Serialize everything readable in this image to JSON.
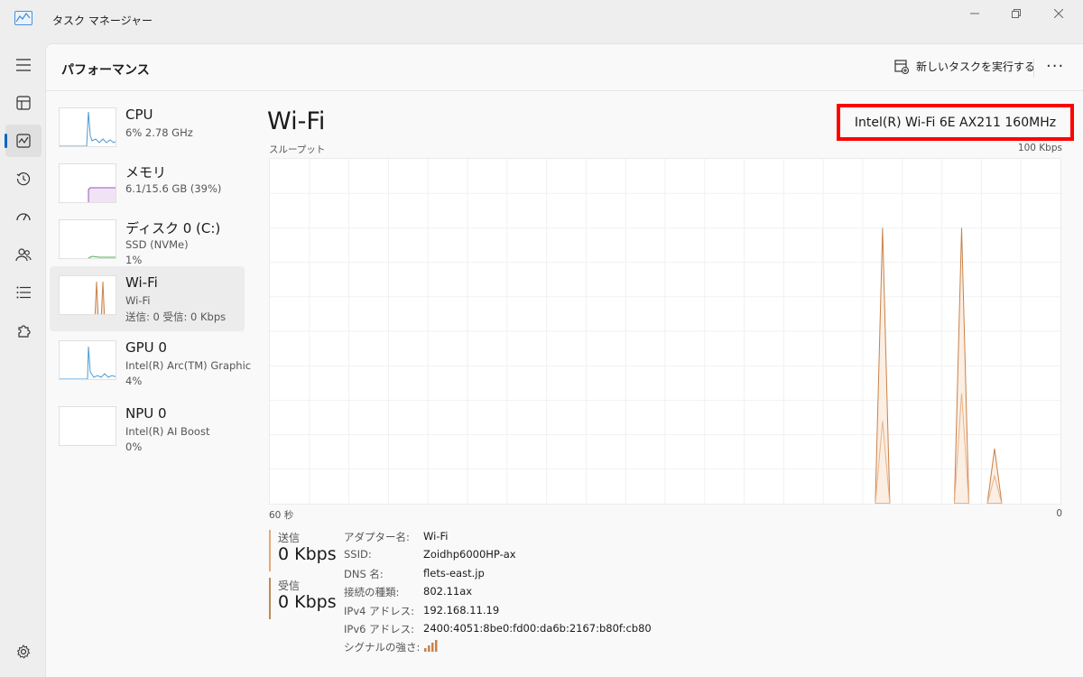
{
  "window": {
    "title": "タスク マネージャー"
  },
  "rail": {
    "items": [
      {
        "name": "menu",
        "icon": "hamburger-menu-icon"
      },
      {
        "name": "processes",
        "icon": "processes-icon"
      },
      {
        "name": "performance",
        "icon": "performance-icon",
        "active": true
      },
      {
        "name": "app-history",
        "icon": "history-icon"
      },
      {
        "name": "startup",
        "icon": "startup-speedometer-icon"
      },
      {
        "name": "users",
        "icon": "users-icon"
      },
      {
        "name": "details",
        "icon": "details-list-icon"
      },
      {
        "name": "services",
        "icon": "services-puzzle-icon"
      }
    ],
    "settings_icon": "settings-gear-icon"
  },
  "header": {
    "title": "パフォーマンス",
    "run_task_label": "新しいタスクを実行する",
    "more_label": "···"
  },
  "devices": [
    {
      "name": "CPU",
      "line1": "6%  2.78 GHz",
      "line2": "",
      "color": "#4a9ad4"
    },
    {
      "name": "メモリ",
      "line1": "6.1/15.6 GB (39%)",
      "line2": "",
      "color": "#9b59b6"
    },
    {
      "name": "ディスク 0 (C:)",
      "line1": "SSD (NVMe)",
      "line2": "1%",
      "color": "#4caf50"
    },
    {
      "name": "Wi-Fi",
      "line1": "Wi-Fi",
      "line2": "送信: 0  受信: 0 Kbps",
      "color": "#c8824a",
      "selected": true
    },
    {
      "name": "GPU 0",
      "line1": "Intel(R) Arc(TM) Graphic",
      "line2": "4%",
      "color": "#4a9ad4"
    },
    {
      "name": "NPU 0",
      "line1": "Intel(R) AI Boost",
      "line2": "0%",
      "color": "#4a9ad4"
    }
  ],
  "detail": {
    "title": "Wi-Fi",
    "adapter": "Intel(R) Wi-Fi 6E AX211 160MHz",
    "graph_label": "スループット",
    "graph_max": "100 Kbps",
    "x_left": "60 秒",
    "x_right": "0",
    "send_label": "送信",
    "send_value": "0 Kbps",
    "recv_label": "受信",
    "recv_value": "0 Kbps",
    "accent": "#c8824a"
  },
  "properties": [
    {
      "key": "アダプター名:",
      "value": "Wi-Fi"
    },
    {
      "key": "SSID:",
      "value": "Zoidhp6000HP-ax"
    },
    {
      "key": "DNS 名:",
      "value": "flets-east.jp"
    },
    {
      "key": "接続の種類:",
      "value": "802.11ax"
    },
    {
      "key": "IPv4 アドレス:",
      "value": "192.168.11.19"
    },
    {
      "key": "IPv6 アドレス:",
      "value": "2400:4051:8be0:fd00:da6b:2167:b80f:cb80"
    },
    {
      "key": "シグナルの強さ:",
      "value": ""
    }
  ],
  "chart_data": {
    "type": "area",
    "x_range": [
      60,
      0
    ],
    "ylim": [
      0,
      100
    ],
    "unit": "Kbps",
    "series": [
      {
        "values_x": [
          60,
          0
        ],
        "note": ""
      }
    ],
    "peaks": [
      {
        "x": 13.5,
        "receive": 80,
        "send": 24
      },
      {
        "x": 7.5,
        "receive": 80,
        "send": 32
      },
      {
        "x": 5.0,
        "receive": 16,
        "send": 8
      }
    ]
  }
}
